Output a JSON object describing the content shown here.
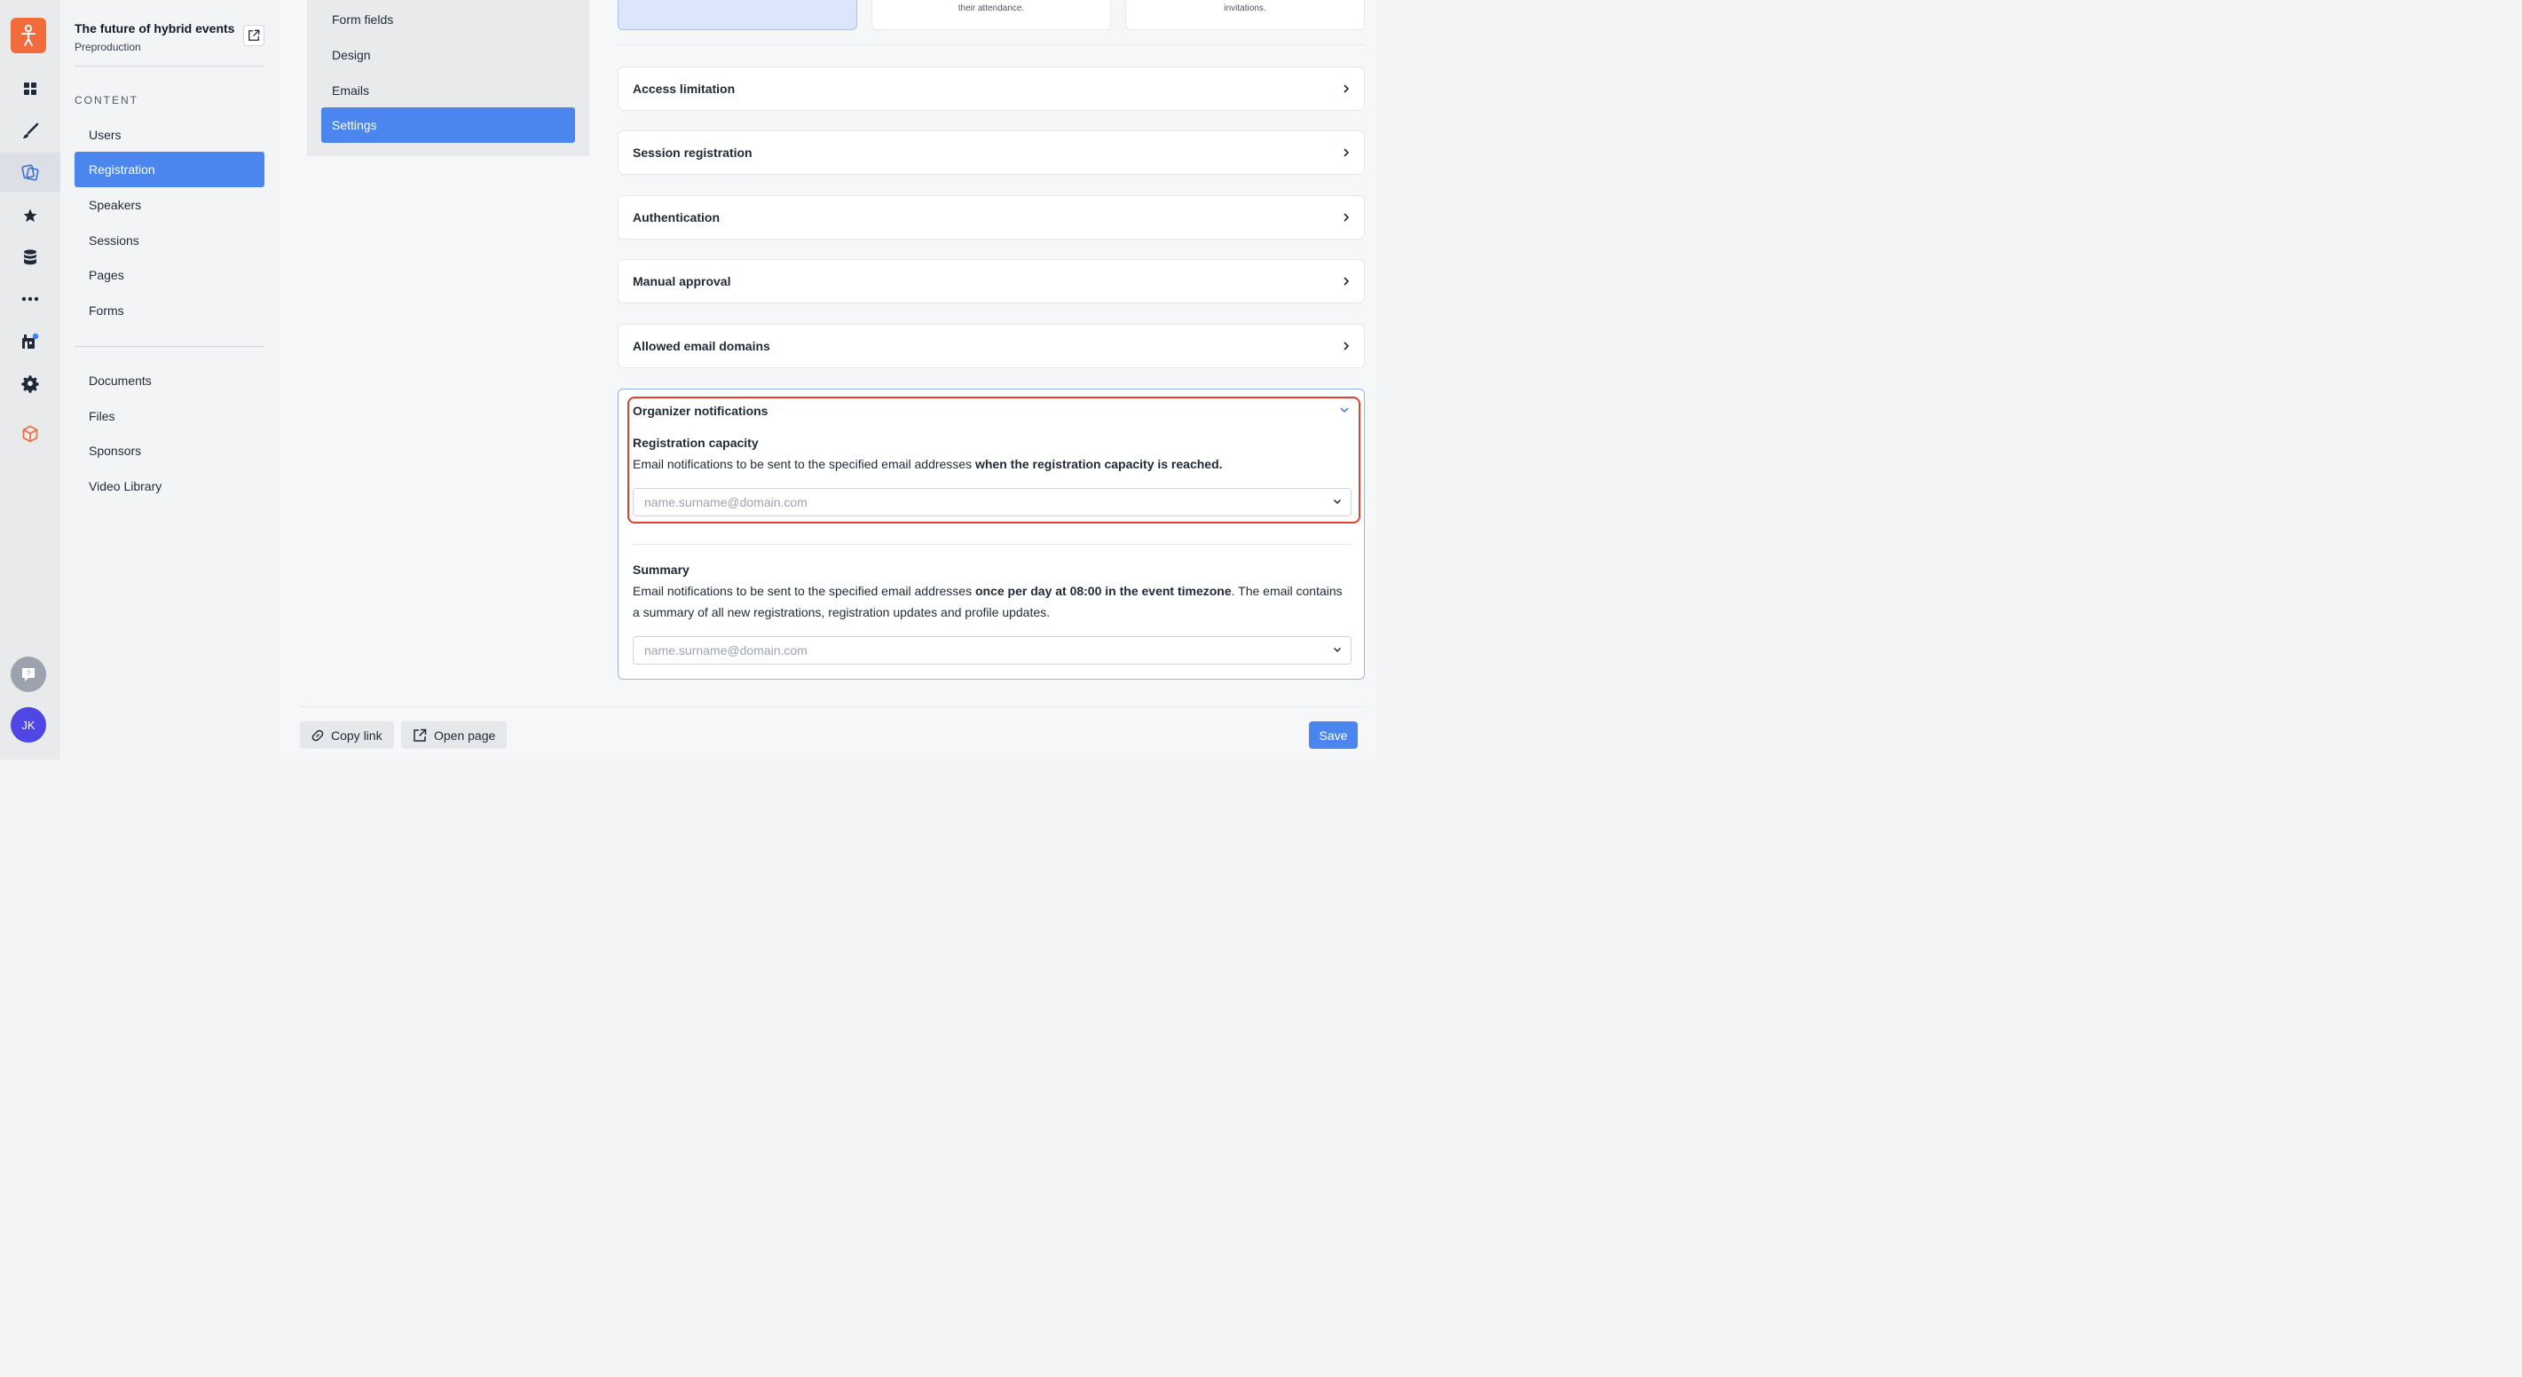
{
  "rail": {
    "icons": [
      "app-logo-icon",
      "dashboard-icon",
      "brush-icon",
      "registration-icon",
      "star-icon",
      "database-icon",
      "more-icon",
      "store-icon",
      "settings-icon",
      "cube-icon"
    ],
    "help_icon": "help-icon",
    "avatar_initials": "JK"
  },
  "sidebar": {
    "event_title": "The future of hybrid events",
    "event_status": "Preproduction",
    "section_label": "CONTENT",
    "items": [
      {
        "label": "Users"
      },
      {
        "label": "Registration"
      },
      {
        "label": "Speakers"
      },
      {
        "label": "Sessions"
      },
      {
        "label": "Pages"
      },
      {
        "label": "Forms"
      }
    ],
    "items2": [
      {
        "label": "Documents"
      },
      {
        "label": "Files"
      },
      {
        "label": "Sponsors"
      },
      {
        "label": "Video Library"
      }
    ]
  },
  "subnav": {
    "items": [
      {
        "label": "Form fields"
      },
      {
        "label": "Design"
      },
      {
        "label": "Emails"
      },
      {
        "label": "Settings"
      }
    ]
  },
  "cards": [
    {
      "text": ""
    },
    {
      "text": "their attendance."
    },
    {
      "text": "invitations."
    }
  ],
  "sections": [
    {
      "label": "Access limitation"
    },
    {
      "label": "Session registration"
    },
    {
      "label": "Authentication"
    },
    {
      "label": "Manual approval"
    },
    {
      "label": "Allowed email domains"
    }
  ],
  "notifications": {
    "title": "Organizer notifications",
    "capacity": {
      "title": "Registration capacity",
      "desc_prefix": "Email notifications to be sent to the specified email addresses ",
      "desc_bold": "when the registration capacity is reached.",
      "placeholder": "name.surname@domain.com"
    },
    "summary": {
      "title": "Summary",
      "desc_prefix": "Email notifications to be sent to the specified email addresses ",
      "desc_bold": "once per day at 08:00 in the event timezone",
      "desc_suffix": ". The email contains a summary of all new registrations, registration updates and profile updates.",
      "placeholder": "name.surname@domain.com"
    }
  },
  "footer": {
    "copy_link": "Copy link",
    "open_page": "Open page",
    "save": "Save"
  },
  "colors": {
    "accent": "#4b86ee",
    "brand": "#f26b3a",
    "highlight": "#e0412d"
  }
}
